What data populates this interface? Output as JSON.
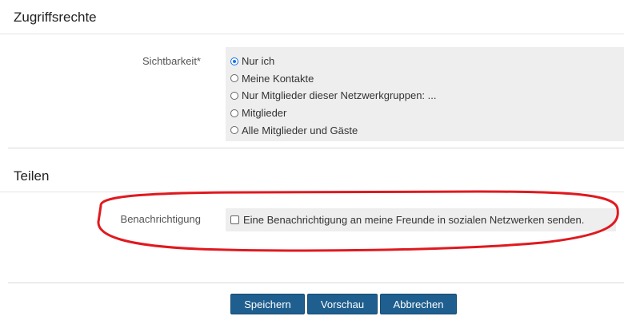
{
  "sections": {
    "access": {
      "title": "Zugriffsrechte"
    },
    "share": {
      "title": "Teilen"
    }
  },
  "visibility": {
    "label": "Sichtbarkeit*",
    "options": [
      {
        "label": "Nur ich",
        "checked": true
      },
      {
        "label": "Meine Kontakte",
        "checked": false
      },
      {
        "label": "Nur Mitglieder dieser Netzwerkgruppen: ...",
        "checked": false
      },
      {
        "label": "Mitglieder",
        "checked": false
      },
      {
        "label": "Alle Mitglieder und Gäste",
        "checked": false
      }
    ]
  },
  "notification": {
    "label": "Benachrichtigung",
    "checkbox_label": "Eine Benachrichtigung an meine Freunde in sozialen Netzwerken senden.",
    "checked": false
  },
  "buttons": {
    "save": "Speichern",
    "preview": "Vorschau",
    "cancel": "Abbrechen"
  },
  "colors": {
    "button_bg": "#1f5f8f",
    "highlight": "#e0191f",
    "panel_bg": "#eeeeee"
  }
}
